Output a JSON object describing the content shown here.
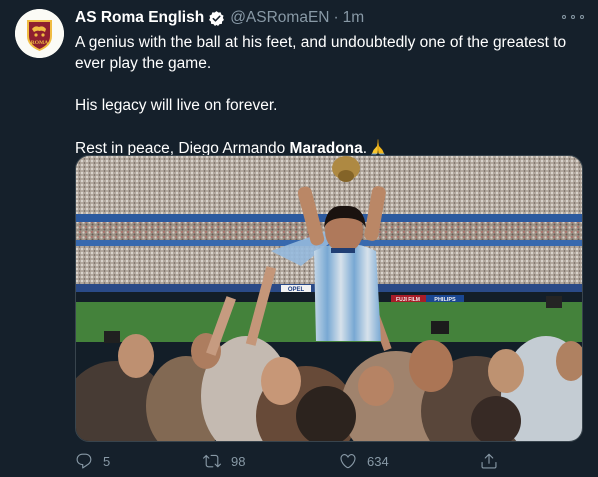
{
  "tweet": {
    "display_name": "AS Roma English",
    "handle": "@ASRomaEN",
    "separator": "·",
    "time": "1m",
    "text_line1": "A genius with the ball at his feet, and undoubtedly one of the greatest to ever play the game.",
    "text_line2": "His legacy will live on forever.",
    "text_line3_prefix": "Rest in peace, Diego Armando ",
    "text_line3_bold": "Maradona",
    "text_line3_suffix": ".",
    "avatar_logo_text": "ROMA",
    "media_banners": [
      "OPEL",
      "FUJI FILM",
      "PHILIPS"
    ]
  },
  "actions": {
    "replies": "5",
    "retweets": "98",
    "likes": "634"
  },
  "icons": {
    "verified": "verified-badge-icon",
    "more": "more-dots-icon",
    "reply": "reply-bubble-icon",
    "retweet": "retweet-arrows-icon",
    "like": "heart-icon",
    "share": "share-upload-icon",
    "pray": "folded-hands-emoji"
  },
  "colors": {
    "background": "#15202b",
    "text": "#ffffff",
    "secondary": "#8899a6",
    "border": "#38444d",
    "roma_red": "#8e1f2f",
    "roma_gold": "#f0bc42"
  }
}
